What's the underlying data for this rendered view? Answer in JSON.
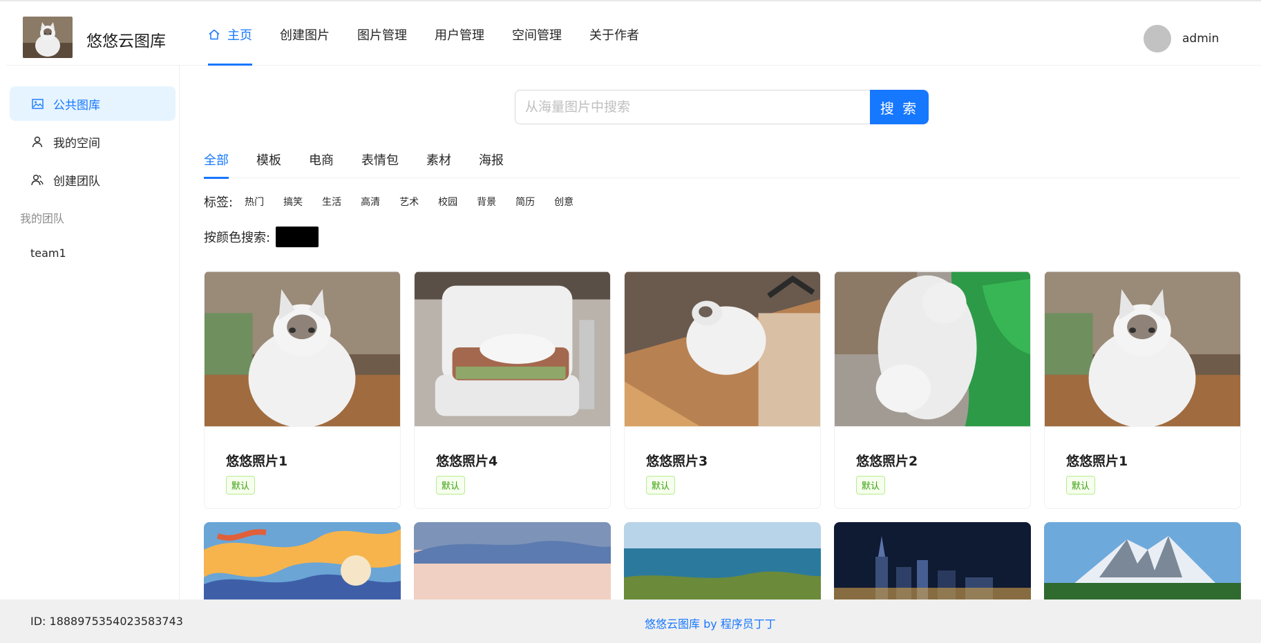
{
  "header": {
    "site_title": "悠悠云图库",
    "nav": [
      {
        "label": "主页",
        "active": true,
        "icon": "home-icon"
      },
      {
        "label": "创建图片"
      },
      {
        "label": "图片管理"
      },
      {
        "label": "用户管理"
      },
      {
        "label": "空间管理"
      },
      {
        "label": "关于作者"
      }
    ],
    "user": {
      "name": "admin"
    }
  },
  "sidebar": {
    "items": [
      {
        "label": "公共图库",
        "icon": "picture-icon",
        "active": true
      },
      {
        "label": "我的空间",
        "icon": "user-icon"
      },
      {
        "label": "创建团队",
        "icon": "team-icon"
      }
    ],
    "group_title": "我的团队",
    "teams": [
      "team1"
    ]
  },
  "search": {
    "placeholder": "从海量图片中搜索",
    "button_label": "搜 索"
  },
  "categories": {
    "tabs": [
      "全部",
      "模板",
      "电商",
      "表情包",
      "素材",
      "海报"
    ],
    "active": "全部"
  },
  "tags": {
    "label": "标签:",
    "items": [
      "热门",
      "搞笑",
      "生活",
      "高清",
      "艺术",
      "校园",
      "背景",
      "简历",
      "创意"
    ]
  },
  "color_filter": {
    "label": "按颜色搜索:",
    "value": "#000000"
  },
  "pictures": [
    {
      "title": "悠悠照片1",
      "tag": "默认"
    },
    {
      "title": "悠悠照片4",
      "tag": "默认"
    },
    {
      "title": "悠悠照片3",
      "tag": "默认"
    },
    {
      "title": "悠悠照片2",
      "tag": "默认"
    },
    {
      "title": "悠悠照片1",
      "tag": "默认"
    }
  ],
  "footer": {
    "id_text": "ID: 1888975354023583743",
    "credit": "悠悠云图库 by 程序员丁丁"
  },
  "colors": {
    "primary": "#1677ff",
    "active_bg": "#e6f4ff",
    "tag_green": "#389e0d",
    "footer_bg": "#f0f0f0"
  }
}
